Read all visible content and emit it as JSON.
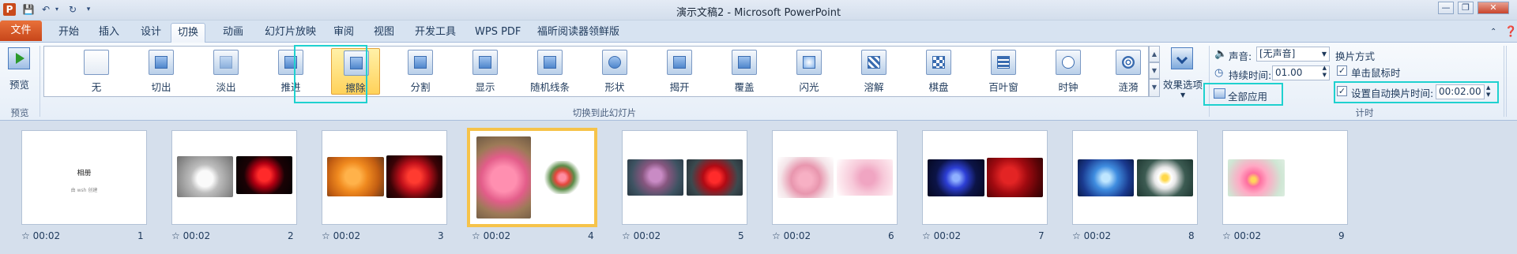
{
  "window": {
    "title": "演示文稿2 - Microsoft PowerPoint",
    "app_icon_letter": "P"
  },
  "tabs": [
    "文件",
    "开始",
    "插入",
    "设计",
    "切换",
    "动画",
    "幻灯片放映",
    "审阅",
    "视图",
    "开发工具",
    "WPS PDF",
    "福昕阅读器领鲜版"
  ],
  "active_tab": "切换",
  "ribbon": {
    "preview_label": "预览",
    "preview_group": "预览",
    "gallery_group": "切换到此幻灯片",
    "timing_group": "计时",
    "effect_options": "效果选项",
    "transitions": [
      "无",
      "切出",
      "淡出",
      "推进",
      "擦除",
      "分割",
      "显示",
      "随机线条",
      "形状",
      "揭开",
      "覆盖",
      "闪光",
      "溶解",
      "棋盘",
      "百叶窗",
      "时钟",
      "涟漪"
    ],
    "selected_transition": "擦除",
    "sound_label": "声音:",
    "sound_value": "[无声音]",
    "duration_label": "持续时间:",
    "duration_value": "01.00",
    "apply_all": "全部应用",
    "advance_title": "换片方式",
    "on_click_label": "单击鼠标时",
    "on_click_checked": true,
    "auto_label": "设置自动换片时间:",
    "auto_checked": true,
    "auto_value": "00:02.00"
  },
  "slides": [
    {
      "number": "1",
      "time": "00:02",
      "title": "相册",
      "subtitle": "由 wsh 创建"
    },
    {
      "number": "2",
      "time": "00:02"
    },
    {
      "number": "3",
      "time": "00:02"
    },
    {
      "number": "4",
      "time": "00:02",
      "active": true
    },
    {
      "number": "5",
      "time": "00:02"
    },
    {
      "number": "6",
      "time": "00:02"
    },
    {
      "number": "7",
      "time": "00:02"
    },
    {
      "number": "8",
      "time": "00:02"
    },
    {
      "number": "9",
      "time": "00:02"
    }
  ],
  "colors": {
    "highlight": "#1fd1cf",
    "file_tab": "#d9561f",
    "selected_item": "#ffd25a",
    "active_slide_border": "#f6c34a"
  }
}
